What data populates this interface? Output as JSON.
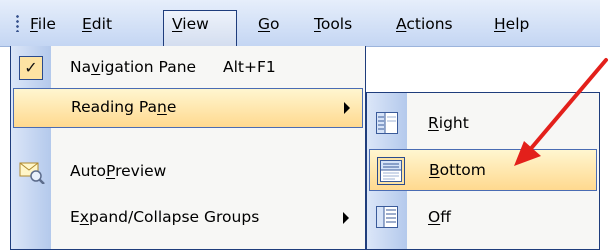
{
  "menubar": {
    "items": [
      {
        "label": "File",
        "u": "F",
        "rest": "ile"
      },
      {
        "label": "Edit",
        "u": "E",
        "rest": "dit"
      },
      {
        "label": "View",
        "u": "V",
        "rest": "iew"
      },
      {
        "label": "Go",
        "u": "G",
        "rest": "o"
      },
      {
        "label": "Tools",
        "u": "T",
        "rest": "ools"
      },
      {
        "label": "Actions",
        "u": "A",
        "rest": "ctions"
      },
      {
        "label": "Help",
        "u": "H",
        "rest": "elp"
      }
    ],
    "active_item": "View"
  },
  "view_menu": {
    "items": [
      {
        "pre": "Na",
        "u": "v",
        "post": "igation Pane",
        "shortcut": "Alt+F1",
        "checked": true
      },
      {
        "pre": "Reading Pa",
        "u": "n",
        "post": "e",
        "submenu": true,
        "highlighted": true
      },
      {
        "pre": "Auto",
        "u": "P",
        "post": "review"
      },
      {
        "pre": "E",
        "u": "x",
        "post": "pand/Collapse Groups",
        "submenu": true
      }
    ]
  },
  "reading_pane_submenu": {
    "items": [
      {
        "u": "R",
        "post": "ight",
        "icon": "reading-pane-right-icon"
      },
      {
        "u": "B",
        "post": "ottom",
        "icon": "reading-pane-bottom-icon",
        "highlighted": true,
        "selected": true
      },
      {
        "u": "O",
        "post": "ff",
        "icon": "reading-pane-off-icon"
      }
    ]
  },
  "colors": {
    "menubar": "#c4d6f3",
    "highlight": "#ffd98f",
    "border": "#1f3d7c",
    "annotation_arrow": "#e3201b"
  }
}
